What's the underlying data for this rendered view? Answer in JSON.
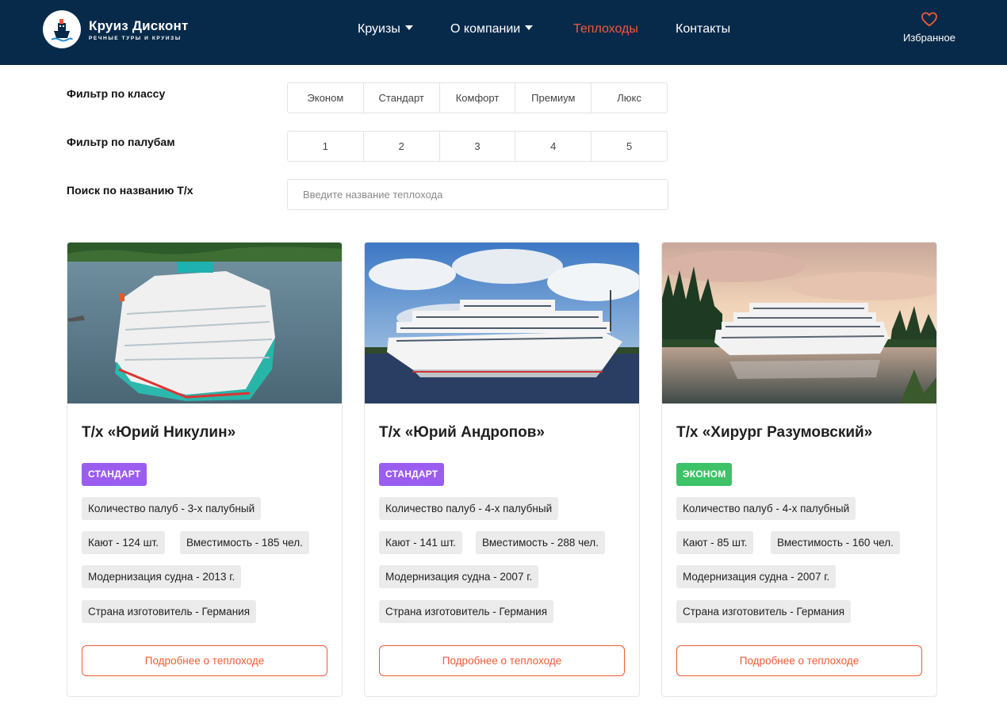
{
  "header": {
    "logo_title": "Круиз Дисконт",
    "logo_subtitle": "РЕЧНЫЕ ТУРЫ И КРУИЗЫ",
    "nav": [
      {
        "label": "Круизы",
        "dropdown": true,
        "active": false
      },
      {
        "label": "О компании",
        "dropdown": true,
        "active": false
      },
      {
        "label": "Теплоходы",
        "dropdown": false,
        "active": true
      },
      {
        "label": "Контакты",
        "dropdown": false,
        "active": false
      }
    ],
    "favorites_label": "Избранное",
    "favorites_icon": "heart-icon"
  },
  "filters": {
    "class_label": "Фильтр по классу",
    "class_options": [
      "Эконом",
      "Стандарт",
      "Комфорт",
      "Премиум",
      "Люкс"
    ],
    "deck_label": "Фильтр по палубам",
    "deck_options": [
      "1",
      "2",
      "3",
      "4",
      "5"
    ],
    "search_label": "Поиск по названию Т/х",
    "search_placeholder": "Введите название теплохода",
    "search_value": ""
  },
  "cards": [
    {
      "title": "Т/х «Юрий Никулин»",
      "badge": "Стандарт",
      "decks": "Количество палуб - 3-х палубный",
      "cabins": "Кают - 124 шт.",
      "capacity": "Вместимость - 185 чел.",
      "modernization": "Модернизация судна - 2013 г.",
      "country": "Страна изготовитель - Германия",
      "button": "Подробнее о теплоходе"
    },
    {
      "title": "Т/х «Юрий Андропов»",
      "badge": "Стандарт",
      "decks": "Количество палуб - 4-х палубный",
      "cabins": "Кают - 141 шт.",
      "capacity": "Вместимость - 288 чел.",
      "modernization": "Модернизация судна - 2007 г.",
      "country": "Страна изготовитель - Германия",
      "button": "Подробнее о теплоходе"
    },
    {
      "title": "Т/х «Хирург Разумовский»",
      "badge": "Эконом",
      "decks": "Количество палуб - 4-х палубный",
      "cabins": "Кают - 85 шт.",
      "capacity": "Вместимость - 160 чел.",
      "modernization": "Модернизация судна - 2007 г.",
      "country": "Страна изготовитель - Германия",
      "button": "Подробнее о теплоходе"
    }
  ],
  "colors": {
    "header_bg": "#082a4a",
    "accent": "#ef5a36",
    "badge_standard": "#9b5cf0",
    "badge_econom": "#3ec267"
  }
}
